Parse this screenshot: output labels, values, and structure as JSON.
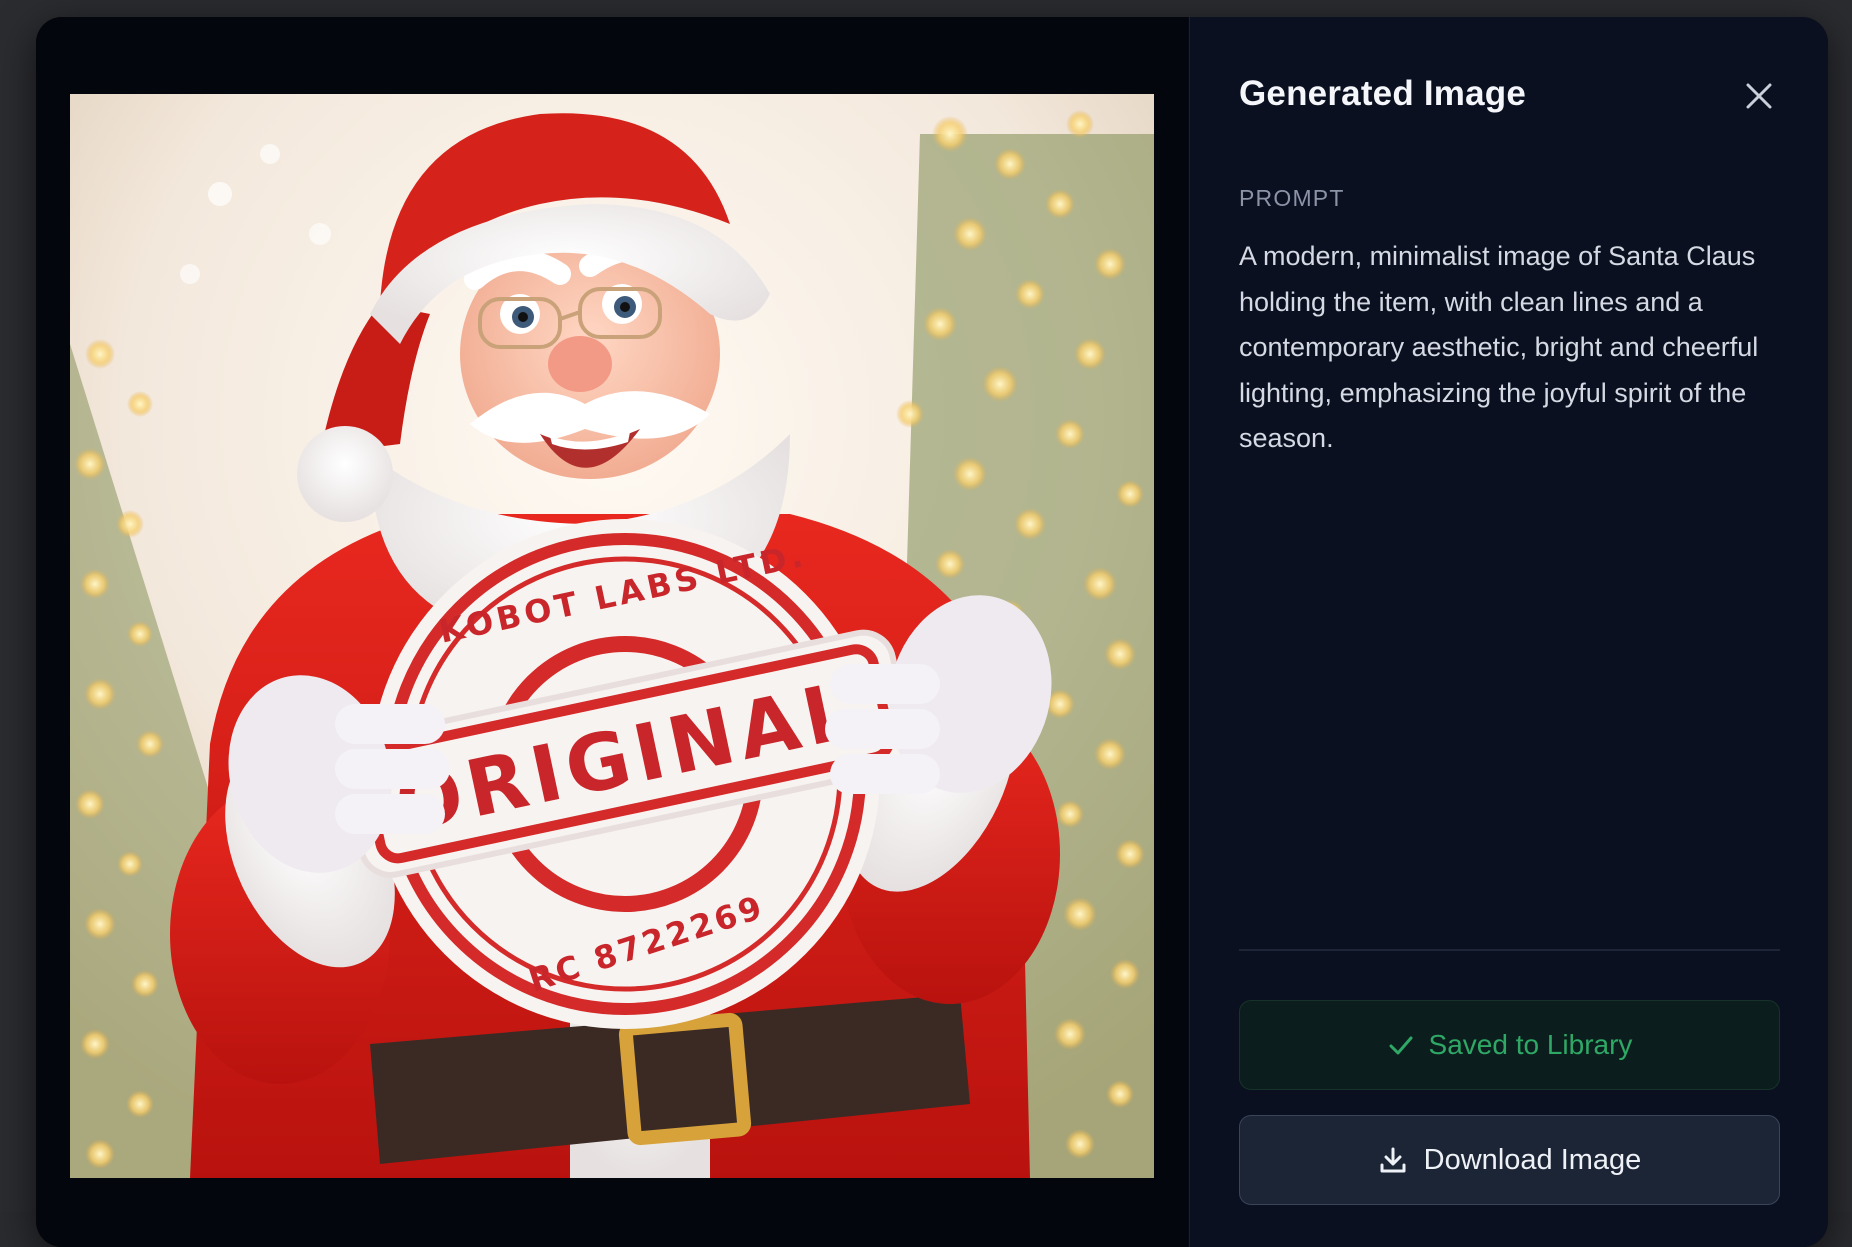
{
  "panel": {
    "title": "Generated Image",
    "close_icon": "close-icon",
    "prompt_label": "PROMPT",
    "prompt_text": "A modern, minimalist image of Santa Claus holding the item, with clean lines and a contemporary aesthetic, bright and cheerful lighting, emphasizing the joyful spirit of the season."
  },
  "actions": {
    "saved_label": "Saved to Library",
    "saved_icon": "check-icon",
    "download_label": "Download Image",
    "download_icon": "download-icon"
  },
  "image": {
    "stamp_top_text": "KOBOT LABS LTD.",
    "stamp_center_text": "ORIGINAL",
    "stamp_bottom_text": "RC 8722269"
  },
  "colors": {
    "accent_green": "#2fa866",
    "stamp_red": "#d42a2a",
    "panel_bg": "#0b1020"
  }
}
